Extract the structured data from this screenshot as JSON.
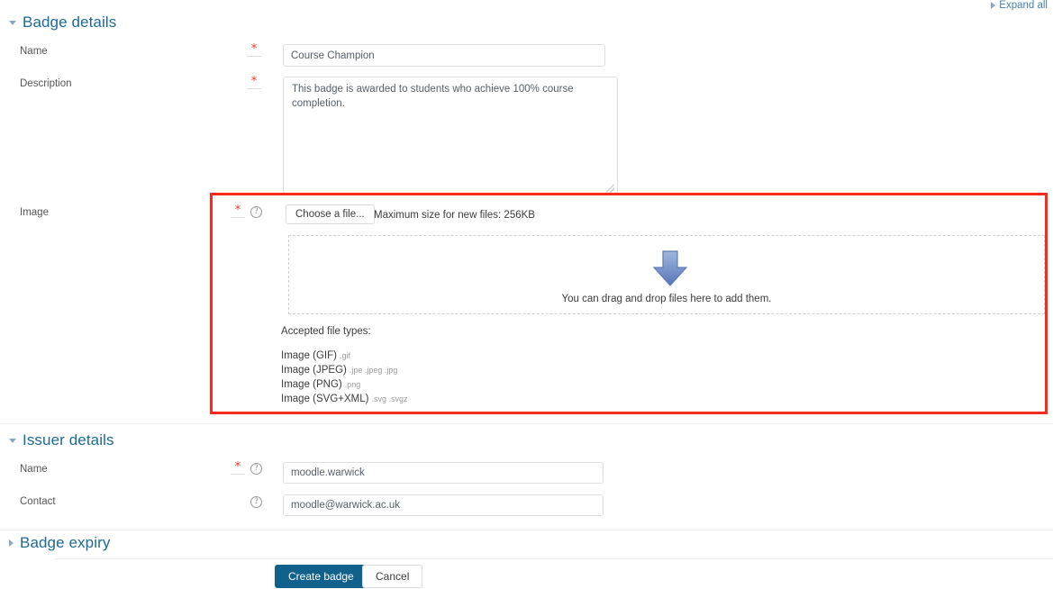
{
  "toolbar": {
    "expand_all_label": "Expand all"
  },
  "sections": {
    "badge_details": {
      "title": "Badge details",
      "expanded": true,
      "fields": {
        "name": {
          "label": "Name",
          "value": "Course Champion",
          "required": true
        },
        "description": {
          "label": "Description",
          "value": "This badge is awarded to students who achieve 100% course completion.",
          "required": true
        },
        "image": {
          "label": "Image",
          "required": true,
          "choose_file_label": "Choose a file...",
          "max_size_text": "Maximum size for new files: 256KB",
          "dropzone_text": "You can drag and drop files here to add them.",
          "accepted_title": "Accepted file types:",
          "accepted_types": [
            {
              "name": "Image (GIF)",
              "extensions": ".gif"
            },
            {
              "name": "Image (JPEG)",
              "extensions": ".jpe .jpeg .jpg"
            },
            {
              "name": "Image (PNG)",
              "extensions": ".png"
            },
            {
              "name": "Image (SVG+XML)",
              "extensions": ".svg .svgz"
            }
          ]
        }
      }
    },
    "issuer_details": {
      "title": "Issuer details",
      "expanded": true,
      "fields": {
        "name": {
          "label": "Name",
          "value": "moodle.warwick",
          "required": true
        },
        "contact": {
          "label": "Contact",
          "value": "moodle@warwick.ac.uk",
          "required": false
        }
      }
    },
    "badge_expiry": {
      "title": "Badge expiry",
      "expanded": false
    }
  },
  "actions": {
    "submit_label": "Create badge",
    "cancel_label": "Cancel"
  },
  "icons": {
    "required_marker": "*",
    "help": "?"
  },
  "colors": {
    "section_heading": "#1d6a96",
    "required_marker": "#e8392c",
    "highlight_border": "#fa2a1e",
    "primary_button": "#11618c",
    "dropzone_arrow": "#6b8dc8"
  }
}
